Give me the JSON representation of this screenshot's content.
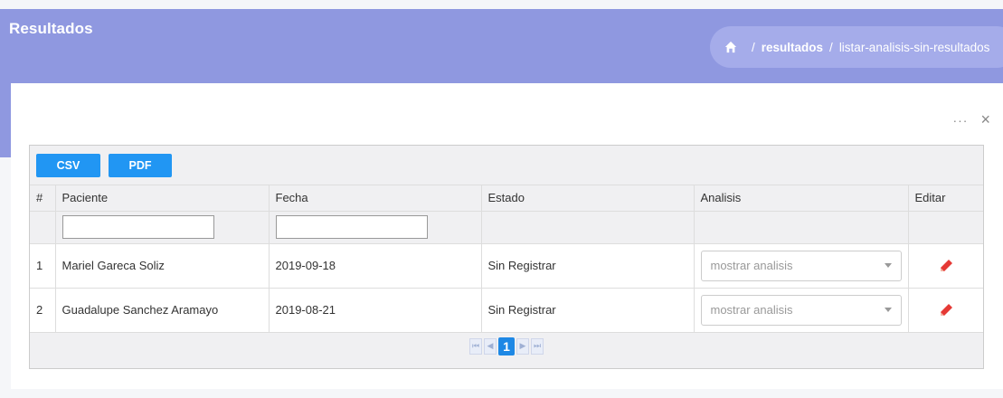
{
  "header": {
    "title": "Resultados",
    "breadcrumb": [
      "resultados",
      "listar-analisis-sin-resultados"
    ],
    "separator": "/"
  },
  "card": {
    "tools": {
      "more": "···",
      "close": "×"
    }
  },
  "toolbar": {
    "csv_label": "CSV",
    "pdf_label": "PDF"
  },
  "table": {
    "columns": [
      "#",
      "Paciente",
      "Fecha",
      "Estado",
      "Analisis",
      "Editar"
    ],
    "rows": [
      {
        "num": "1",
        "paciente": "Mariel Gareca Soliz",
        "fecha": "2019-09-18",
        "estado": "Sin Registrar",
        "analisis": "mostrar analisis"
      },
      {
        "num": "2",
        "paciente": "Guadalupe Sanchez Aramayo",
        "fecha": "2019-08-21",
        "estado": "Sin Registrar",
        "analisis": "mostrar analisis"
      }
    ]
  },
  "pager": {
    "current_page": "1"
  },
  "colors": {
    "header": "#8f98e0",
    "button": "#2196f3",
    "edit": "#e53935"
  }
}
